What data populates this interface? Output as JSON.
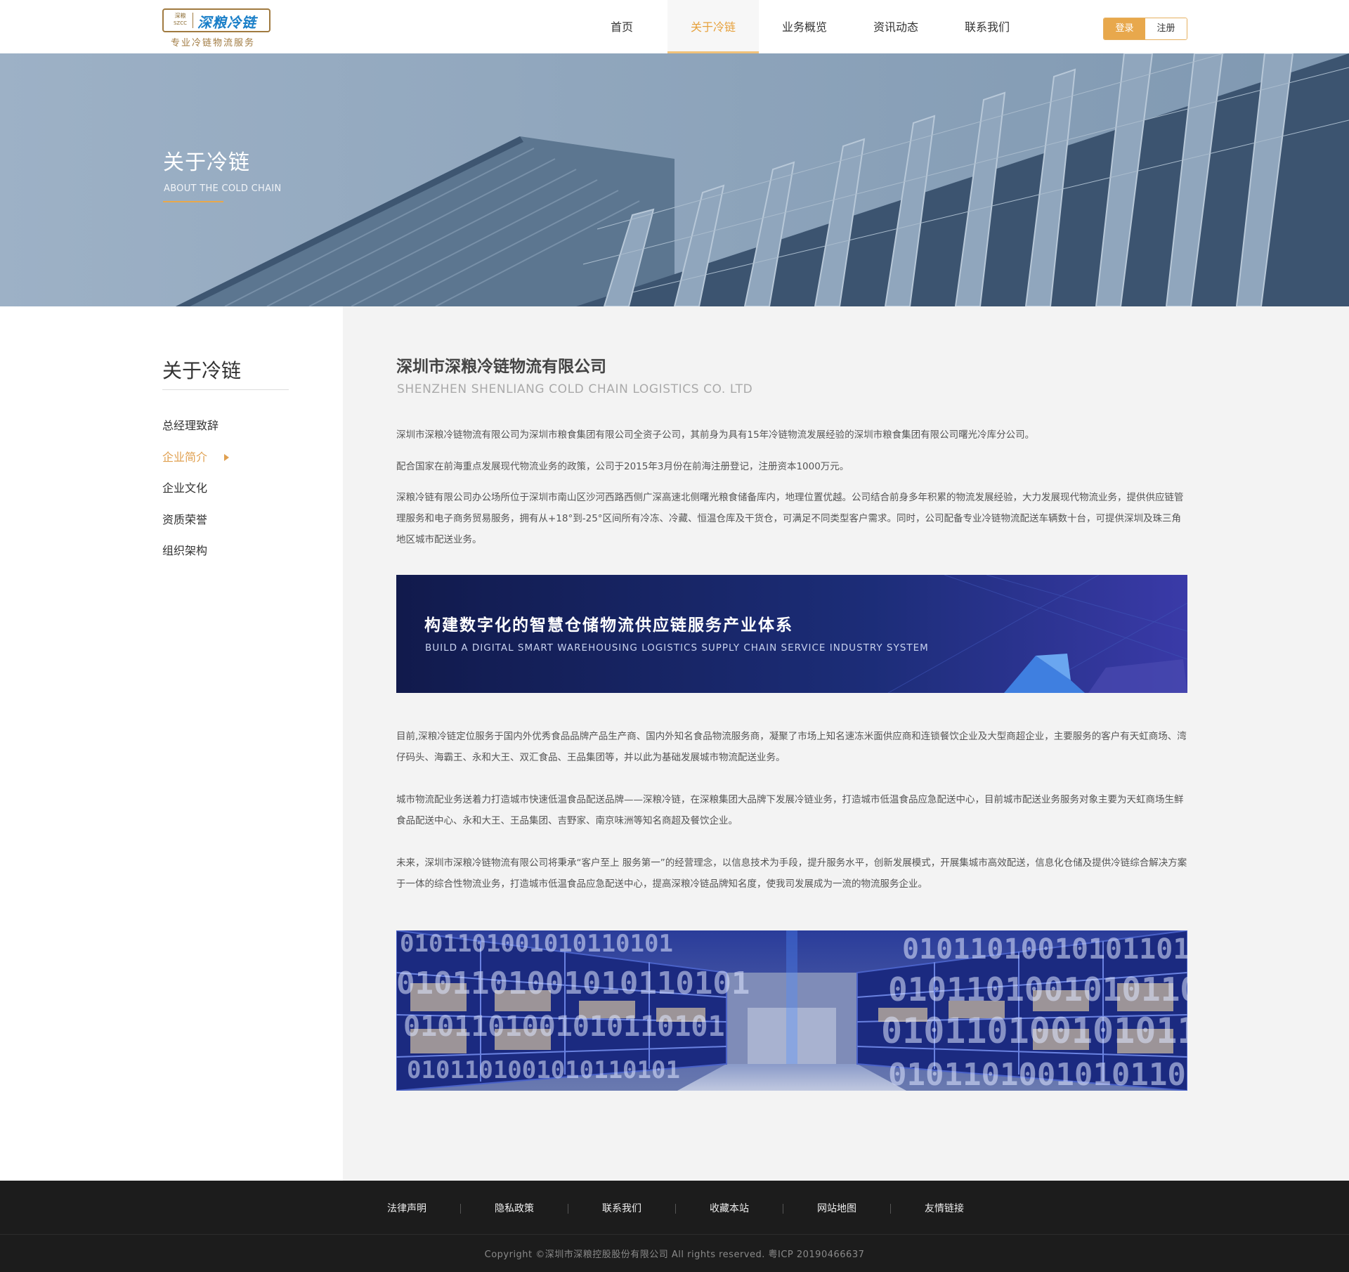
{
  "brand": {
    "seal_top": "深粮",
    "seal_bottom": "SZCC",
    "name": "深粮冷链",
    "slogan": "专业冷链物流服务"
  },
  "nav": {
    "items": [
      "首页",
      "关于冷链",
      "业务概览",
      "资讯动态",
      "联系我们"
    ],
    "active_index": 1
  },
  "auth": {
    "login": "登录",
    "register": "注册"
  },
  "banner": {
    "title": "关于冷链",
    "subtitle": "ABOUT THE COLD CHAIN"
  },
  "sidebar": {
    "title": "关于冷链",
    "items": [
      "总经理致辞",
      "企业简介",
      "企业文化",
      "资质荣誉",
      "组织架构"
    ],
    "active_index": 1
  },
  "main": {
    "company_title": "深圳市深粮冷链物流有限公司",
    "company_subtitle": "SHENZHEN SHENLIANG COLD CHAIN LOGISTICS CO. LTD",
    "paragraphs": [
      "深圳市深粮冷链物流有限公司为深圳市粮食集团有限公司全资子公司，其前身为具有15年冷链物流发展经验的深圳市粮食集团有限公司曙光冷库分公司。",
      "配合国家在前海重点发展现代物流业务的政策，公司于2015年3月份在前海注册登记，注册资本1000万元。",
      "深粮冷链有限公司办公场所位于深圳市南山区沙河西路西侧广深高速北侧曙光粮食储备库内，地理位置优越。公司结合前身多年积累的物流发展经验，大力发展现代物流业务，提供供应链管理服务和电子商务贸易服务，拥有从+18°到-25°区间所有冷冻、冷藏、恒温仓库及干货仓，可满足不同类型客户需求。同时，公司配备专业冷链物流配送车辆数十台，可提供深圳及珠三角地区城市配送业务。",
      "目前,深粮冷链定位服务于国内外优秀食品品牌产品生产商、国内外知名食品物流服务商，凝聚了市场上知名速冻米面供应商和连锁餐饮企业及大型商超企业，主要服务的客户有天虹商场、湾仔码头、海霸王、永和大王、双汇食品、王品集团等，并以此为基础发展城市物流配送业务。",
      "城市物流配业务送着力打造城市快速低温食品配送品牌——深粮冷链，在深粮集团大品牌下发展冷链业务，打造城市低温食品应急配送中心，目前城市配送业务服务对象主要为天虹商场生鲜食品配送中心、永和大王、王品集团、吉野家、南京味洲等知名商超及餐饮企业。",
      "未来，深圳市深粮冷链物流有限公司将秉承“客户至上 服务第一”的经营理念，以信息技术为手段，提升服务水平，创新发展模式，开展集城市高效配送，信息化仓储及提供冷链综合解决方案于一体的综合性物流业务，打造城市低温食品应急配送中心，提高深粮冷链品牌知名度，使我司发展成为一流的物流服务企业。"
    ],
    "tagline_title": "构建数字化的智慧仓储物流供应链服务产业体系",
    "tagline_subtitle": "BUILD A DIGITAL SMART WAREHOUSING LOGISTICS SUPPLY CHAIN SERVICE INDUSTRY SYSTEM",
    "binary_text": "0101101001010110101"
  },
  "footer": {
    "links": [
      "法律声明",
      "隐私政策",
      "联系我们",
      "收藏本站",
      "网站地图",
      "友情链接"
    ],
    "copyright": "Copyright  ©深圳市深粮控股股份有限公司  All  rights  reserved.  粤ICP  20190466637"
  },
  "colors": {
    "accent": "#e8a84c",
    "footer_bg": "#1c1c1c",
    "main_bg": "#f3f3f3"
  }
}
